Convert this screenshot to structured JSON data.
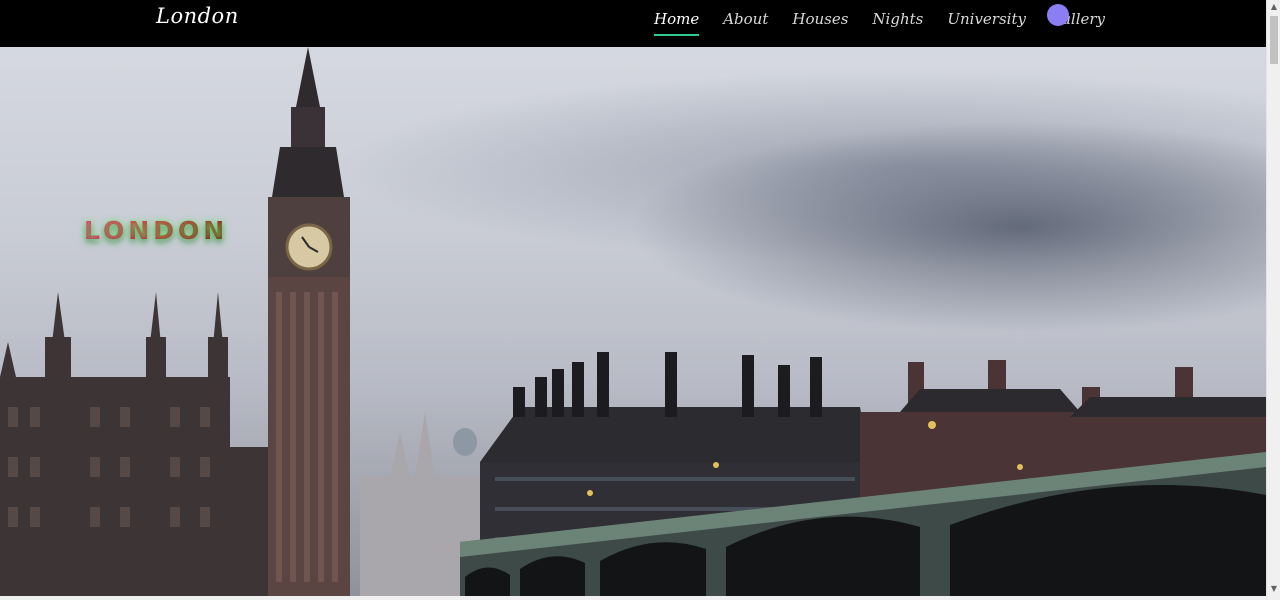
{
  "nav": {
    "brand": "London",
    "links": [
      {
        "label": "Home",
        "active": true
      },
      {
        "label": "About",
        "active": false
      },
      {
        "label": "Houses",
        "active": false
      },
      {
        "label": "Nights",
        "active": false
      },
      {
        "label": "University",
        "active": false
      },
      {
        "label": "Gallery",
        "active": false
      }
    ],
    "avatar_color": "#8a7ef2",
    "active_underline_color": "#2ecc8f"
  },
  "hero": {
    "title": "LONDON",
    "image_subject": "Big Ben, Houses of Parliament and Westminster Bridge at dusk"
  },
  "scrollbar": {
    "up_icon": "▲",
    "down_icon": "▼"
  }
}
